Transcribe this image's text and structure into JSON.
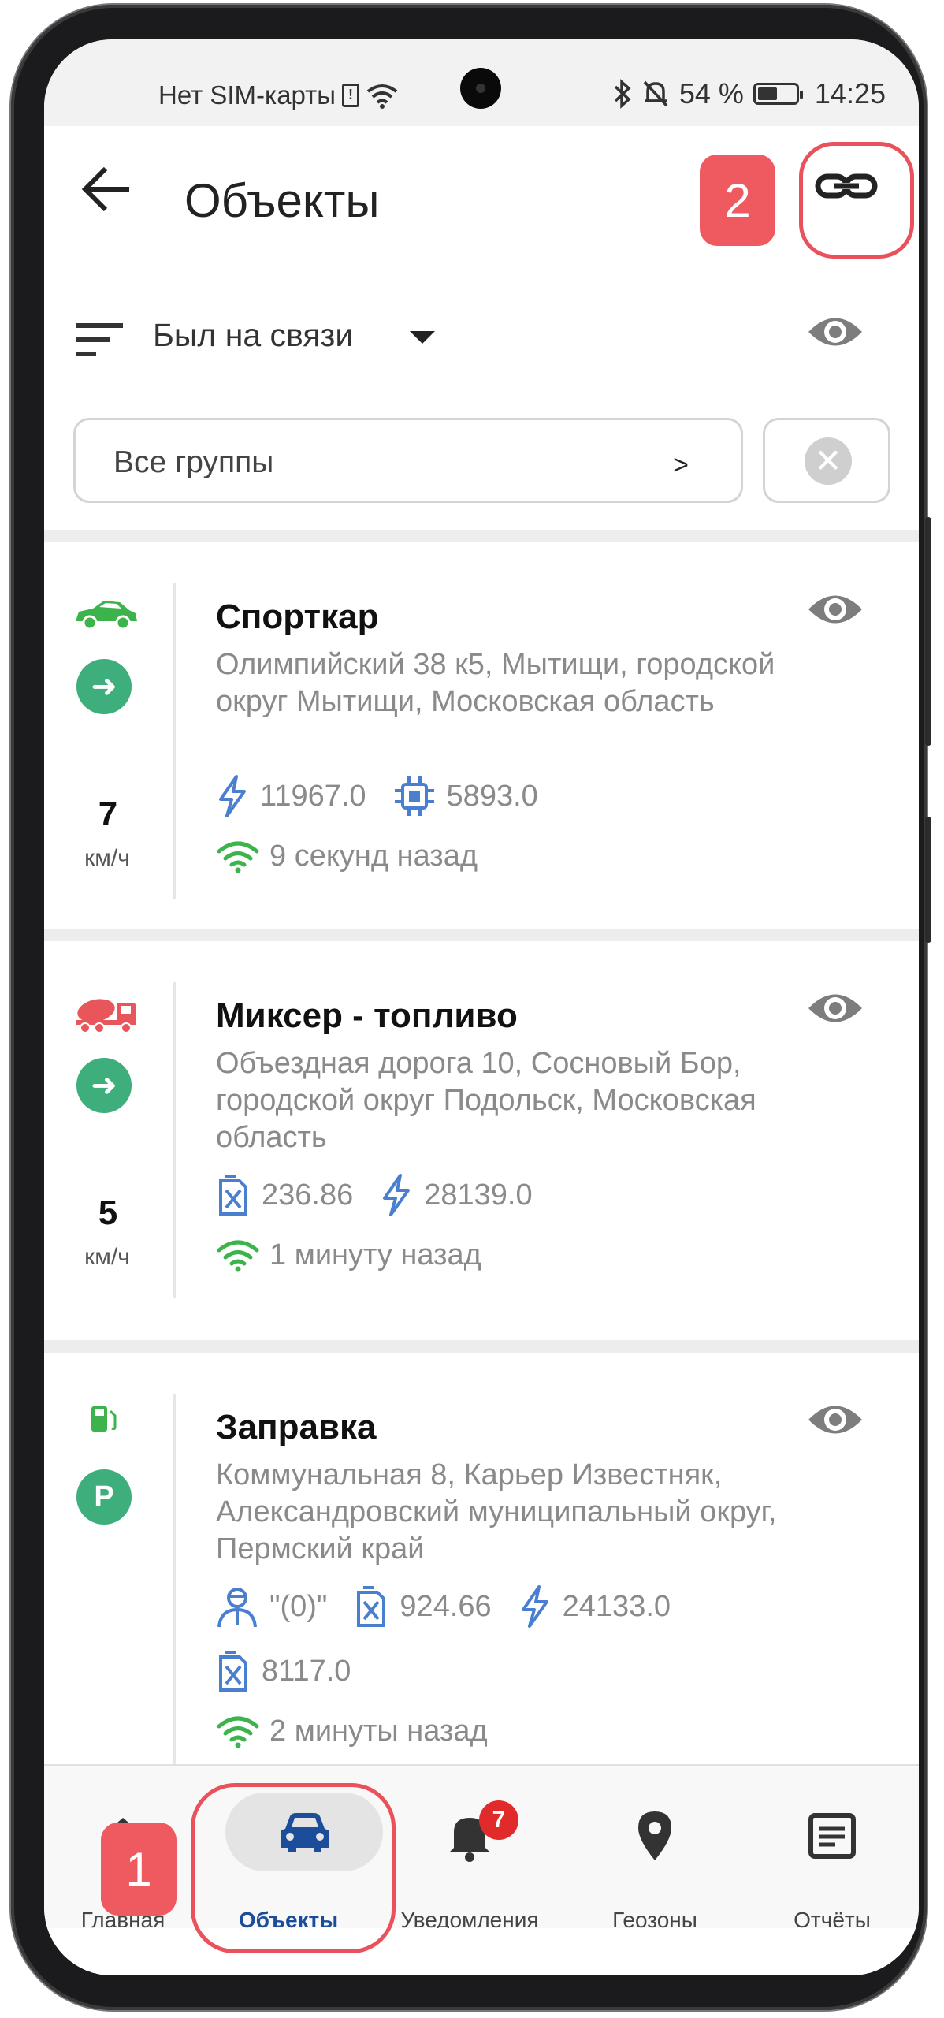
{
  "status_bar": {
    "carrier": "Нет SIM-карты",
    "battery_percent": "54 %",
    "time": "14:25"
  },
  "header": {
    "title": "Объекты",
    "back_icon": "arrow-left-icon",
    "link_icon": "link-icon",
    "callout_2": "2"
  },
  "filter": {
    "sort_label": "Был на связи",
    "group_label": "Все группы",
    "group_chevron": ">",
    "clear_glyph": "✕"
  },
  "objects": [
    {
      "name": "Спорткар",
      "address": "Олимпийский  38 к5, Мытищи, городской округ Мытищи, Московская область",
      "status": "moving",
      "status_glyph": "➜",
      "speed": "7",
      "speed_unit": "км/ч",
      "type_icon": "sportscar-icon",
      "type_color": "#3cb44b",
      "sensors": [
        {
          "icon": "voltage-icon",
          "value": "11967.0"
        },
        {
          "icon": "chip-icon",
          "value": "5893.0"
        }
      ],
      "last_seen": "9 секунд назад"
    },
    {
      "name": "Миксер - топливо",
      "address": "Объездная дорога 10, Сосновый Бор, городской округ Подольск, Московская область",
      "status": "moving",
      "status_glyph": "➜",
      "speed": "5",
      "speed_unit": "км/ч",
      "type_icon": "mixer-truck-icon",
      "type_color": "#e8555b",
      "sensors": [
        {
          "icon": "fuel-canister-icon",
          "value": "236.86"
        },
        {
          "icon": "voltage-icon",
          "value": "28139.0"
        }
      ],
      "last_seen": "1 минуту назад"
    },
    {
      "name": "Заправка",
      "address": "Коммунальная  8, Карьер Известняк, Александровский муниципальный округ, Пермский край",
      "status": "parked",
      "status_glyph": "P",
      "speed": "",
      "speed_unit": "",
      "type_icon": "fuel-station-icon",
      "type_color": "#3cb44b",
      "sensors": [
        {
          "icon": "driver-icon",
          "value": "\"(0)\""
        },
        {
          "icon": "fuel-canister-icon",
          "value": "924.66"
        },
        {
          "icon": "voltage-icon",
          "value": "24133.0"
        },
        {
          "icon": "fuel-canister-icon",
          "value": "8117.0"
        }
      ],
      "last_seen": "2 минуты назад"
    }
  ],
  "bottom_nav": {
    "items": [
      {
        "label": "Главная",
        "icon": "home-icon"
      },
      {
        "label": "Объекты",
        "icon": "car-icon",
        "active": true
      },
      {
        "label": "Уведомления",
        "icon": "bell-icon",
        "badge": "7"
      },
      {
        "label": "Геозоны",
        "icon": "map-pin-icon"
      },
      {
        "label": "Отчёты",
        "icon": "report-icon"
      }
    ],
    "callout_1": "1"
  },
  "colors": {
    "accent_blue": "#1b4d9b",
    "sensor_blue": "#4a7fd0",
    "status_green": "#3eaf7c",
    "callout_red": "#ef5a60"
  }
}
